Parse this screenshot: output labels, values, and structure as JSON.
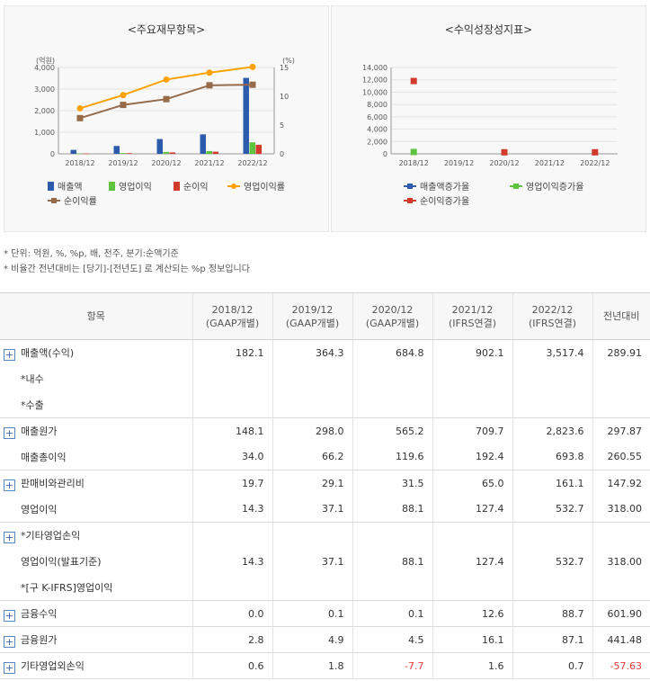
{
  "colors": {
    "blue": "#2e5cad",
    "green": "#5ec43f",
    "red": "#d23a2c",
    "orange": "#ffa200",
    "brown": "#966b4a",
    "neg": "#e53b3b",
    "expand_icon": "#5b86c5"
  },
  "chart_data": [
    {
      "type": "bar+line",
      "title": "<주요재무항목>",
      "categories": [
        "2018/12",
        "2019/12",
        "2020/12",
        "2021/12",
        "2022/12"
      ],
      "y_left": {
        "unit": "(억원)",
        "range": [
          0,
          4000
        ],
        "ticks": [
          "0",
          "1,000",
          "2,000",
          "3,000",
          "4,000"
        ]
      },
      "y_right": {
        "unit": "(%)",
        "range": [
          0,
          15
        ],
        "ticks": [
          "0",
          "5",
          "10",
          "15"
        ]
      },
      "bars": [
        {
          "name": "매출액",
          "color": "#2e5cad",
          "values": [
            182.1,
            364.3,
            684.8,
            902.1,
            3517.4
          ]
        },
        {
          "name": "영업이익",
          "color": "#5ec43f",
          "values": [
            14.3,
            37.1,
            88.1,
            127.4,
            532.7
          ]
        },
        {
          "name": "순이익",
          "color": "#d23a2c",
          "values": [
            10,
            30,
            65,
            100,
            420
          ]
        }
      ],
      "lines": [
        {
          "name": "영업이익률",
          "color": "#ffa200",
          "marker": "circle",
          "values": [
            7.9,
            10.2,
            12.9,
            14.1,
            15.1
          ]
        },
        {
          "name": "순이익률",
          "color": "#966b4a",
          "marker": "square",
          "values": [
            6.2,
            8.5,
            9.5,
            11.9,
            12.0
          ]
        }
      ],
      "legend": [
        "매출액",
        "영업이익",
        "순이익",
        "영업이익률",
        "순이익률"
      ]
    },
    {
      "type": "scatter",
      "title": "<수익성장성지표>",
      "categories": [
        "2018/12",
        "2019/12",
        "2020/12",
        "2021/12",
        "2022/12"
      ],
      "y": {
        "range": [
          0,
          14000
        ],
        "ticks": [
          "0",
          "2,000",
          "4,000",
          "6,000",
          "8,000",
          "10,000",
          "12,000",
          "14,000"
        ]
      },
      "series": [
        {
          "name": "매출액증가율",
          "color": "#2e5cad",
          "values": [
            null,
            null,
            null,
            null,
            null
          ]
        },
        {
          "name": "영업이익증가율",
          "color": "#5ec43f",
          "values": [
            300,
            null,
            null,
            null,
            null
          ]
        },
        {
          "name": "순이익증가율",
          "color": "#d23a2c",
          "values": [
            11800,
            null,
            250,
            null,
            250
          ]
        }
      ],
      "legend": [
        "매출액증가율",
        "영업이익증가율",
        "순이익증가율"
      ]
    }
  ],
  "notes": [
    "* 단위: 억원, %, %p, 배, 천주, 분기:순액기준",
    "* 비율간 전년대비는 [당기]-[전년도] 로 계산되는 %p 정보입니다"
  ],
  "table": {
    "headers": [
      {
        "line1": "항목",
        "line2": ""
      },
      {
        "line1": "2018/12",
        "line2": "(GAAP개별)"
      },
      {
        "line1": "2019/12",
        "line2": "(GAAP개별)"
      },
      {
        "line1": "2020/12",
        "line2": "(GAAP개별)"
      },
      {
        "line1": "2021/12",
        "line2": "(IFRS연결)"
      },
      {
        "line1": "2022/12",
        "line2": "(IFRS연결)"
      },
      {
        "line1": "전년대비",
        "line2": ""
      }
    ],
    "expand_symbol": "+",
    "rows": [
      {
        "label": "매출액(수익)",
        "expand": true,
        "values": [
          "182.1",
          "364.3",
          "684.8",
          "902.1",
          "3,517.4",
          "289.91"
        ],
        "neg": []
      },
      {
        "label": "*내수",
        "expand": false,
        "values": [
          "",
          "",
          "",
          "",
          "",
          ""
        ],
        "neg": []
      },
      {
        "label": "*수출",
        "expand": false,
        "values": [
          "",
          "",
          "",
          "",
          "",
          ""
        ],
        "neg": [],
        "end": true
      },
      {
        "label": "매출원가",
        "expand": true,
        "values": [
          "148.1",
          "298.0",
          "565.2",
          "709.7",
          "2,823.6",
          "297.87"
        ],
        "neg": []
      },
      {
        "label": "매출총이익",
        "expand": false,
        "values": [
          "34.0",
          "66.2",
          "119.6",
          "192.4",
          "693.8",
          "260.55"
        ],
        "neg": [],
        "end": true
      },
      {
        "label": "판매비와관리비",
        "expand": true,
        "values": [
          "19.7",
          "29.1",
          "31.5",
          "65.0",
          "161.1",
          "147.92"
        ],
        "neg": []
      },
      {
        "label": "영업이익",
        "expand": false,
        "values": [
          "14.3",
          "37.1",
          "88.1",
          "127.4",
          "532.7",
          "318.00"
        ],
        "neg": [],
        "end": true
      },
      {
        "label": "*기타영업손익",
        "expand": true,
        "values": [
          "",
          "",
          "",
          "",
          "",
          ""
        ],
        "neg": []
      },
      {
        "label": "영업이익(발표기준)",
        "expand": false,
        "values": [
          "14.3",
          "37.1",
          "88.1",
          "127.4",
          "532.7",
          "318.00"
        ],
        "neg": []
      },
      {
        "label": "*[구 K-IFRS]영업이익",
        "expand": false,
        "values": [
          "",
          "",
          "",
          "",
          "",
          ""
        ],
        "neg": [],
        "end": true
      },
      {
        "label": "금융수익",
        "expand": true,
        "values": [
          "0.0",
          "0.1",
          "0.1",
          "12.6",
          "88.7",
          "601.90"
        ],
        "neg": [],
        "end": true
      },
      {
        "label": "금융원가",
        "expand": true,
        "values": [
          "2.8",
          "4.9",
          "4.5",
          "16.1",
          "87.1",
          "441.48"
        ],
        "neg": [],
        "end": true
      },
      {
        "label": "기타영업외손익",
        "expand": true,
        "values": [
          "0.6",
          "1.8",
          "-7.7",
          "1.6",
          "0.7",
          "-57.63"
        ],
        "neg": [
          2,
          5
        ],
        "end": true
      }
    ]
  }
}
